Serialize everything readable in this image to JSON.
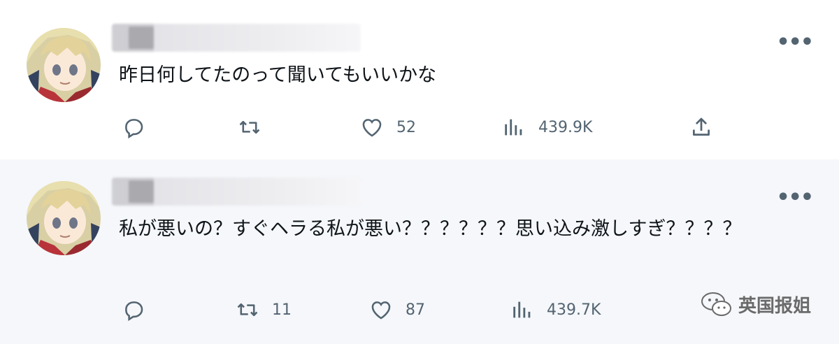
{
  "tweets": [
    {
      "text": "昨日何してたのって聞いてもいいかな",
      "reply_count": "",
      "retweet_count": "",
      "like_count": "52",
      "view_count": "439.9K"
    },
    {
      "text": "私が悪いの？すぐヘラる私が悪い？？？？？？思い込み激しすぎ？？？？",
      "reply_count": "",
      "retweet_count": "11",
      "like_count": "87",
      "view_count": "439.7K"
    }
  ],
  "more_icon": "more-horizontal-icon",
  "watermark": {
    "text": "英国报姐",
    "icon": "wechat-icon"
  },
  "colors": {
    "icon": "#536471",
    "text": "#0f1419",
    "row2_bg": "#f5f7fa"
  }
}
